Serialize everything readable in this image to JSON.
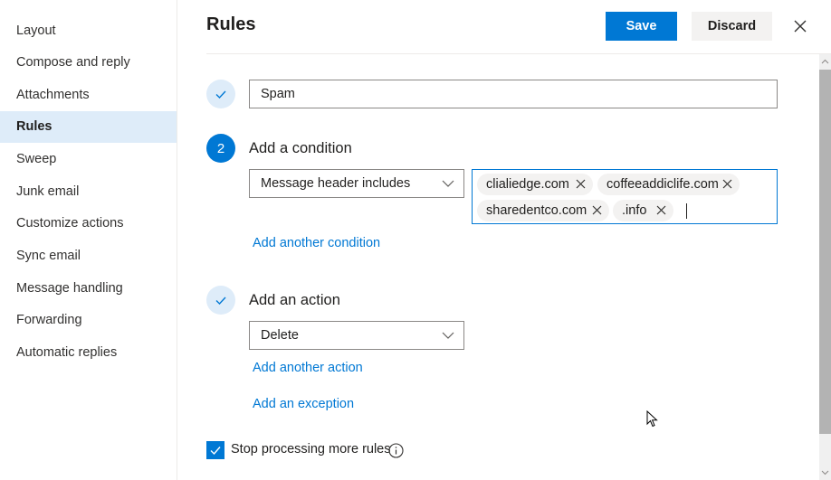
{
  "sidebar": {
    "items": [
      {
        "label": "Layout",
        "active": false
      },
      {
        "label": "Compose and reply",
        "active": false
      },
      {
        "label": "Attachments",
        "active": false
      },
      {
        "label": "Rules",
        "active": true
      },
      {
        "label": "Sweep",
        "active": false
      },
      {
        "label": "Junk email",
        "active": false
      },
      {
        "label": "Customize actions",
        "active": false
      },
      {
        "label": "Sync email",
        "active": false
      },
      {
        "label": "Message handling",
        "active": false
      },
      {
        "label": "Forwarding",
        "active": false
      },
      {
        "label": "Automatic replies",
        "active": false
      }
    ]
  },
  "header": {
    "title": "Rules",
    "save_label": "Save",
    "discard_label": "Discard",
    "close_icon": "close-icon"
  },
  "rule": {
    "name_value": "Spam",
    "condition": {
      "step_number": "2",
      "label": "Add a condition",
      "dropdown_value": "Message header includes",
      "tags": [
        "clialiedge.com",
        "coffeeaddiclife.com",
        "sharedentco.com",
        ".info"
      ],
      "add_link": "Add another condition"
    },
    "action": {
      "label": "Add an action",
      "dropdown_value": "Delete",
      "add_link": "Add another action"
    },
    "exception_link": "Add an exception",
    "stop_processing": {
      "label": "Stop processing more rules",
      "checked": true
    }
  },
  "colors": {
    "accent": "#0078d4",
    "selected_nav": "#deecf9",
    "tag_bg": "#f3f2f1"
  }
}
